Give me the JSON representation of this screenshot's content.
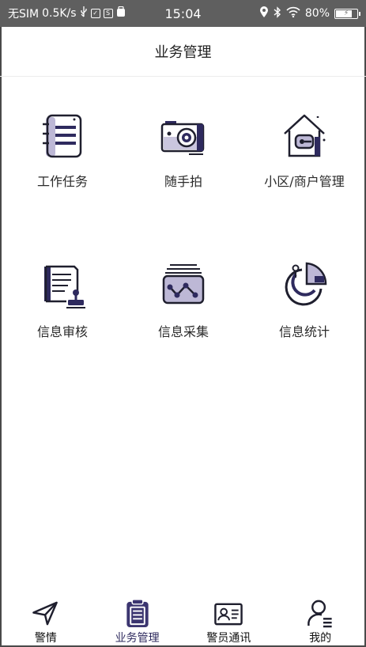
{
  "status_bar": {
    "carrier": "无SIM",
    "speed": "0.5K/s",
    "time": "15:04",
    "battery": "80%",
    "battery_level": 0.8
  },
  "header": {
    "title": "业务管理"
  },
  "colors": {
    "icon_dark": "#1f1f2e",
    "icon_accent": "#3b3570",
    "icon_light": "#bdb8d6",
    "status_bg": "#5f5f5f"
  },
  "grid": {
    "items": [
      {
        "label": "工作任务",
        "icon": "notebook-icon"
      },
      {
        "label": "随手拍",
        "icon": "camera-icon"
      },
      {
        "label": "小区/商户管理",
        "icon": "house-icon"
      },
      {
        "label": "信息审核",
        "icon": "document-stamp-icon"
      },
      {
        "label": "信息采集",
        "icon": "data-collect-icon"
      },
      {
        "label": "信息统计",
        "icon": "pie-chart-icon"
      }
    ]
  },
  "tabbar": {
    "active": 1,
    "items": [
      {
        "label": "警情",
        "icon": "send-icon"
      },
      {
        "label": "业务管理",
        "icon": "clipboard-icon"
      },
      {
        "label": "警员通讯",
        "icon": "contact-card-icon"
      },
      {
        "label": "我的",
        "icon": "user-icon"
      }
    ]
  }
}
